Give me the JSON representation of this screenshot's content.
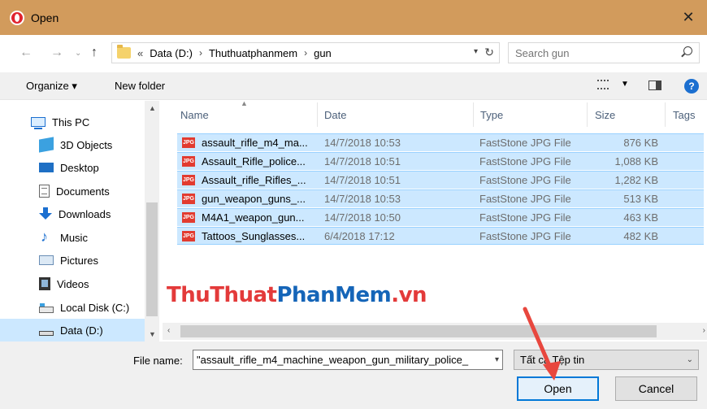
{
  "window": {
    "title": "Open"
  },
  "address": {
    "crumbs": [
      "«",
      "Data (D:)",
      "›",
      "Thuthuatphanmem",
      "›",
      "gun"
    ],
    "search_placeholder": "Search gun"
  },
  "toolbar": {
    "organize": "Organize ▾",
    "new_folder": "New folder"
  },
  "nav": {
    "items": [
      {
        "label": "This PC",
        "icon": "this-pc-icon"
      },
      {
        "label": "3D Objects",
        "icon": "3d-objects-icon"
      },
      {
        "label": "Desktop",
        "icon": "desktop-icon"
      },
      {
        "label": "Documents",
        "icon": "documents-icon"
      },
      {
        "label": "Downloads",
        "icon": "downloads-icon"
      },
      {
        "label": "Music",
        "icon": "music-icon"
      },
      {
        "label": "Pictures",
        "icon": "pictures-icon"
      },
      {
        "label": "Videos",
        "icon": "videos-icon"
      },
      {
        "label": "Local Disk (C:)",
        "icon": "local-disk-icon"
      },
      {
        "label": "Data (D:)",
        "icon": "data-drive-icon"
      }
    ]
  },
  "columns": {
    "name": "Name",
    "date": "Date",
    "type": "Type",
    "size": "Size",
    "tags": "Tags"
  },
  "files": [
    {
      "name": "assault_rifle_m4_ma...",
      "date": "14/7/2018 10:53",
      "type": "FastStone JPG File",
      "size": "876 KB",
      "badge": "JPG"
    },
    {
      "name": "Assault_Rifle_police...",
      "date": "14/7/2018 10:51",
      "type": "FastStone JPG File",
      "size": "1,088 KB",
      "badge": "JPG"
    },
    {
      "name": "Assault_rifle_Rifles_...",
      "date": "14/7/2018 10:51",
      "type": "FastStone JPG File",
      "size": "1,282 KB",
      "badge": "JPG"
    },
    {
      "name": "gun_weapon_guns_...",
      "date": "14/7/2018 10:53",
      "type": "FastStone JPG File",
      "size": "513 KB",
      "badge": "JPG"
    },
    {
      "name": "M4A1_weapon_gun...",
      "date": "14/7/2018 10:50",
      "type": "FastStone JPG File",
      "size": "463 KB",
      "badge": "JPG"
    },
    {
      "name": "Tattoos_Sunglasses...",
      "date": "6/4/2018 17:12",
      "type": "FastStone JPG File",
      "size": "482 KB",
      "badge": "JPG"
    }
  ],
  "bottom": {
    "file_name_label": "File name:",
    "file_name_value": "\"assault_rifle_m4_machine_weapon_gun_military_police_",
    "filter": "Tất cả Tệp tin",
    "open_label": "Open",
    "cancel_label": "Cancel"
  },
  "watermark": {
    "part1": "ThuThuat",
    "part2": "PhanMem",
    "part3": ".vn"
  },
  "colors": {
    "titlebar": "#d29b5c",
    "selection": "#cce8ff",
    "accent": "#0078d7",
    "arrow": "#e8473e"
  }
}
